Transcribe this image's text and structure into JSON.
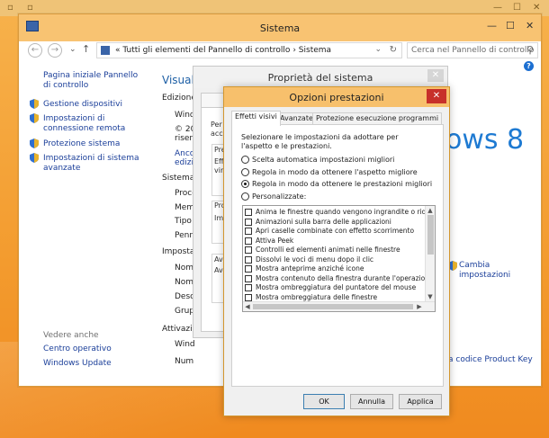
{
  "window": {
    "title": "Sistema",
    "minimize": "—",
    "maximize": "☐",
    "close": "✕"
  },
  "address": {
    "back": "←",
    "forward": "→",
    "up": "↑",
    "chevron": "«",
    "breadcrumb_root": "Tutti gli elementi del Pannello di controllo",
    "breadcrumb_sep": "›",
    "breadcrumb_current": "Sistema",
    "dropdown": "⌄",
    "refresh": "↻",
    "search_placeholder": "Cerca nel Pannello di controllo",
    "search_icon": "⚲"
  },
  "help_label": "?",
  "left_pane": {
    "home_link": "Pagina iniziale Pannello di controllo",
    "items": [
      "Gestione dispositivi",
      "Impostazioni di connessione remota",
      "Protezione sistema",
      "Impostazioni di sistema avanzate"
    ],
    "see_also": "Vedere anche",
    "links": [
      "Centro operativo",
      "Windows Update"
    ]
  },
  "content": {
    "heading": "Visualiz",
    "edition": "Edizione",
    "wind1": "Wind",
    "copy": "© 20",
    "riserv": "riserv",
    "anco": "Anco",
    "edizio": "edizio",
    "system": "Sistema",
    "system_rows": [
      "Proce",
      "Mem",
      "Tipo",
      "Penn"
    ],
    "settings": "Impostaz",
    "settings_rows": [
      "Nom",
      "Nom",
      "Desc",
      "Grup"
    ],
    "activation": "Attivazi",
    "activation_rows": [
      "Wind",
      "Num"
    ],
    "windows8": "ows 8",
    "change_settings": "Cambia impostazioni",
    "product_key": "a codice Product Key"
  },
  "prop_dialog": {
    "title": "Proprietà del sistema",
    "close": "✕",
    "frag_per": "Per",
    "frag_acce": "acce",
    "frag_pre": "Pre",
    "frag_effe": "Effe",
    "frag_virt": "virtu",
    "frag_pro": "Pro",
    "frag_imp": "Imp",
    "frag_avv": "Avv",
    "frag_inf": "Info"
  },
  "opz_dialog": {
    "title": "Opzioni prestazioni",
    "close": "✕",
    "tabs": [
      "Effetti visivi",
      "Avanzate",
      "Protezione esecuzione programmi"
    ],
    "description": "Selezionare le impostazioni da adottare per l'aspetto e le prestazioni.",
    "radios": [
      {
        "label": "Scelta automatica impostazioni migliori",
        "selected": false
      },
      {
        "label": "Regola in modo da ottenere l'aspetto migliore",
        "selected": false
      },
      {
        "label": "Regola in modo da ottenere le prestazioni migliori",
        "selected": true
      },
      {
        "label": "Personalizzate:",
        "selected": false
      }
    ],
    "effects": [
      "Anima le finestre quando vengono ingrandite o ridotte ad i",
      "Animazioni sulla barra delle applicazioni",
      "Apri caselle combinate con effetto scorrimento",
      "Attiva Peek",
      "Controlli ed elementi animati nelle finestre",
      "Dissolvi le voci di menu dopo il clic",
      "Mostra anteprime anziché icone",
      "Mostra contenuto della finestra durante l'operazione di tra",
      "Mostra ombreggiatura del puntatore del mouse",
      "Mostra ombreggiatura delle finestre"
    ],
    "scroll_up": "▲",
    "scroll_down": "▼",
    "scroll_left": "◀",
    "scroll_right": "▶",
    "buttons": {
      "ok": "OK",
      "cancel": "Annulla",
      "apply": "Applica"
    }
  }
}
